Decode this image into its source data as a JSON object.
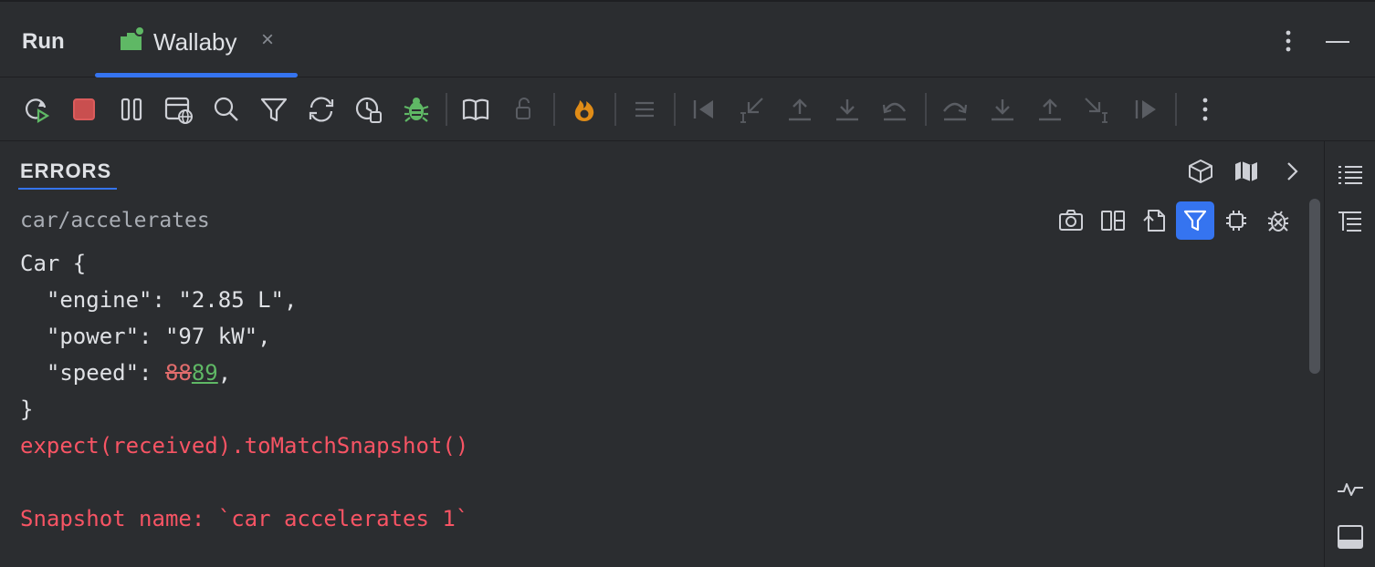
{
  "tabs": {
    "run_label": "Run",
    "wallaby_label": "Wallaby",
    "close_glyph": "×",
    "active_color": "#3574f0"
  },
  "toolbar": {
    "icons": [
      "rerun-icon",
      "stop-icon",
      "pause-icon",
      "browser-icon",
      "search-icon",
      "filter-icon",
      "sync-icon",
      "history-icon",
      "debug-bug-icon",
      "book-icon",
      "lock-icon",
      "flame-icon",
      "list-icon",
      "step-back-icon",
      "step-into-icon",
      "upload-icon",
      "download-icon",
      "step-out-icon",
      "step-over-icon",
      "down-arrow-icon",
      "up-arrow-icon",
      "step-cursor-icon",
      "step-forward-icon",
      "more-vertical-icon"
    ]
  },
  "errors": {
    "title": "ERRORS",
    "test_path_prefix": "car",
    "test_path_sep": "/",
    "test_path_name": "accelerates"
  },
  "code": {
    "line1": "Car {",
    "line2": "  \"engine\": \"2.85 L\",",
    "line3": "  \"power\": \"97 kW\",",
    "line4_prefix": "  \"speed\": ",
    "line4_old": "88",
    "line4_new": "89",
    "line4_suffix": ",",
    "line5": "}",
    "line6": "expect(received).toMatchSnapshot()",
    "line7": "",
    "line8": "Snapshot name: `car accelerates 1`"
  },
  "colors": {
    "background": "#2b2d30",
    "error_text": "#f75464",
    "diff_removed": "#e06c6c",
    "diff_added": "#5fb865",
    "accent": "#3574f0"
  }
}
